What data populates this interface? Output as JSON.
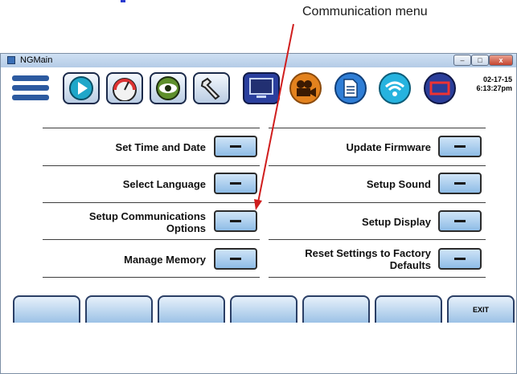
{
  "annotation": {
    "text": "Communication menu"
  },
  "window": {
    "title": "NGMain",
    "minimize": "–",
    "maximize": "□",
    "close": "x"
  },
  "toolbar": {
    "buttons": [
      {
        "icon": "menu-lines-icon"
      },
      {
        "icon": "play-icon"
      },
      {
        "icon": "gauge-icon"
      },
      {
        "icon": "eye-icon"
      },
      {
        "icon": "wrench-icon"
      },
      {
        "icon": "monitor-icon"
      },
      {
        "icon": "video-camera-icon"
      },
      {
        "icon": "document-icon"
      },
      {
        "icon": "wifi-icon"
      },
      {
        "icon": "rectangle-icon"
      }
    ],
    "date": "02-17-15",
    "time": "6:13:27pm"
  },
  "settings": {
    "left": [
      {
        "label": "Set Time and Date"
      },
      {
        "label": "Select Language"
      },
      {
        "label": "Setup Communications Options"
      },
      {
        "label": "Manage Memory"
      }
    ],
    "right": [
      {
        "label": "Update Firmware"
      },
      {
        "label": "Setup Sound"
      },
      {
        "label": "Setup Display"
      },
      {
        "label": "Reset Settings to Factory Defaults"
      }
    ]
  },
  "bottom_bar": {
    "exit_label": "EXIT"
  },
  "colors": {
    "accent": "#8ebce6",
    "arrow": "#d01e1e"
  }
}
